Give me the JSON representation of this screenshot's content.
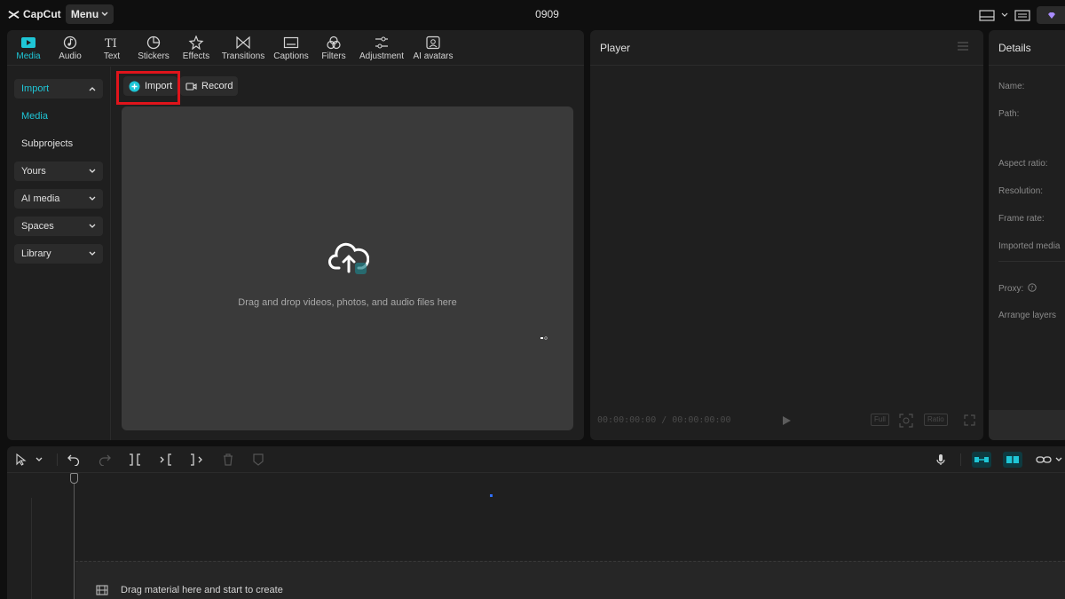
{
  "app": {
    "brand": "CapCut",
    "menu_label": "Menu",
    "project_title": "0909"
  },
  "tool_tabs": [
    {
      "label": "Media",
      "icon": "media-icon",
      "active": true
    },
    {
      "label": "Audio",
      "icon": "audio-icon"
    },
    {
      "label": "Text",
      "icon": "text-icon"
    },
    {
      "label": "Stickers",
      "icon": "stickers-icon"
    },
    {
      "label": "Effects",
      "icon": "effects-icon"
    },
    {
      "label": "Transitions",
      "icon": "transitions-icon"
    },
    {
      "label": "Captions",
      "icon": "captions-icon"
    },
    {
      "label": "Filters",
      "icon": "filters-icon"
    },
    {
      "label": "Adjustment",
      "icon": "adjustment-icon"
    },
    {
      "label": "AI avatars",
      "icon": "ai-avatars-icon"
    }
  ],
  "sidebar": {
    "import": "Import",
    "media": "Media",
    "subprojects": "Subprojects",
    "yours": "Yours",
    "ai_media": "AI media",
    "spaces": "Spaces",
    "library": "Library"
  },
  "media_area": {
    "import_button": "Import",
    "record_button": "Record",
    "drop_hint": "Drag and drop videos, photos, and audio files here"
  },
  "player": {
    "title": "Player",
    "timecode": "00:00:00:00 / 00:00:00:00",
    "full_label": "Full",
    "ratio_label": "Ratio"
  },
  "details": {
    "title": "Details",
    "name_label": "Name:",
    "path_label": "Path:",
    "aspect_ratio_label": "Aspect ratio:",
    "resolution_label": "Resolution:",
    "frame_rate_label": "Frame rate:",
    "imported_media_label": "Imported media",
    "proxy_label": "Proxy:",
    "arrange_layers_label": "Arrange layers"
  },
  "timeline": {
    "drop_hint": "Drag material here and start to create"
  },
  "colors": {
    "accent": "#1fc6d6",
    "highlight": "#e0141b",
    "panel": "#1f1f1f",
    "background": "#0f0f0f"
  }
}
